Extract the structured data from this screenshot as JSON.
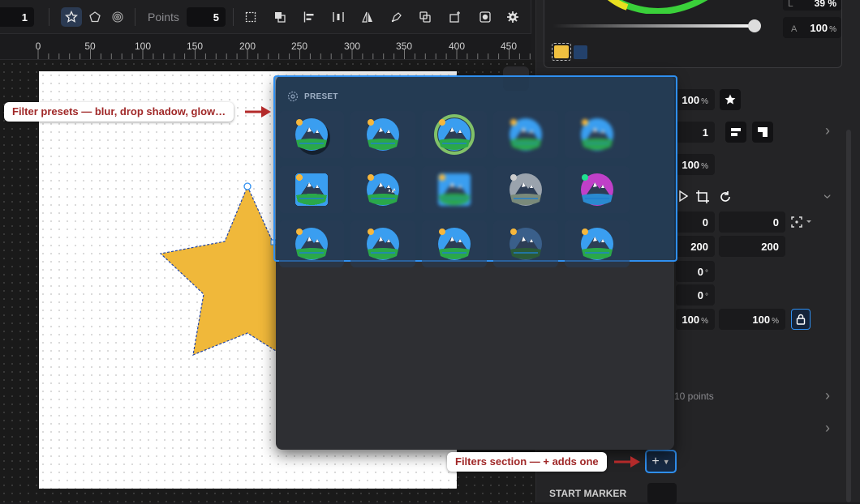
{
  "toolbar": {
    "stroke_value": "1",
    "points_label": "Points",
    "points_value": "5"
  },
  "ruler": {
    "ticks": [
      "0",
      "50",
      "100",
      "150",
      "200",
      "250",
      "300",
      "350",
      "400",
      "450"
    ]
  },
  "panel": {
    "color_l_label": "L",
    "color_l_value": "39 %",
    "alpha_label": "A",
    "alpha_value": "100",
    "alpha_unit": "%",
    "opacity_value": "100",
    "opacity_unit": "%",
    "layer_value": "1",
    "row3_value": "100",
    "row3_unit": "%",
    "x_value": "0",
    "y_value": "0",
    "w_value": "200",
    "h_value": "200",
    "rot_value": "0",
    "rot_unit": "°",
    "skew_value": "0",
    "skew_unit": "°",
    "scale_x_value": "100",
    "scale_x_unit": "%",
    "scale_y_value": "100",
    "scale_y_unit": "%",
    "points_summary": "10 points",
    "add_filter_label": "+",
    "start_marker_label": "START MARKER"
  },
  "popup": {
    "header": "PRESET",
    "presets": [
      {
        "name": "drop-shadow-preset"
      },
      {
        "name": "plain-preset"
      },
      {
        "name": "glow-preset"
      },
      {
        "name": "blur-preset"
      },
      {
        "name": "soft-blur-preset"
      },
      {
        "name": "pixel-preset"
      },
      {
        "name": "noise-preset"
      },
      {
        "name": "pixel-soft-preset"
      },
      {
        "name": "grayscale-preset"
      },
      {
        "name": "neon-preset"
      },
      {
        "name": "plain-preset-2"
      },
      {
        "name": "plain-preset-3"
      },
      {
        "name": "plain-preset-4"
      },
      {
        "name": "dark-preset"
      },
      {
        "name": "plain-preset-5"
      }
    ]
  },
  "callouts": {
    "presets": "Filter presets — blur, drop shadow, glow…",
    "filters": "Filters section — + adds one"
  },
  "colors": {
    "accent": "#2f8ff0",
    "star_fill": "#f0b83a",
    "swatch_yellow": "#f0c040",
    "swatch_navy": "#23416b",
    "callout_text": "#a02828"
  }
}
